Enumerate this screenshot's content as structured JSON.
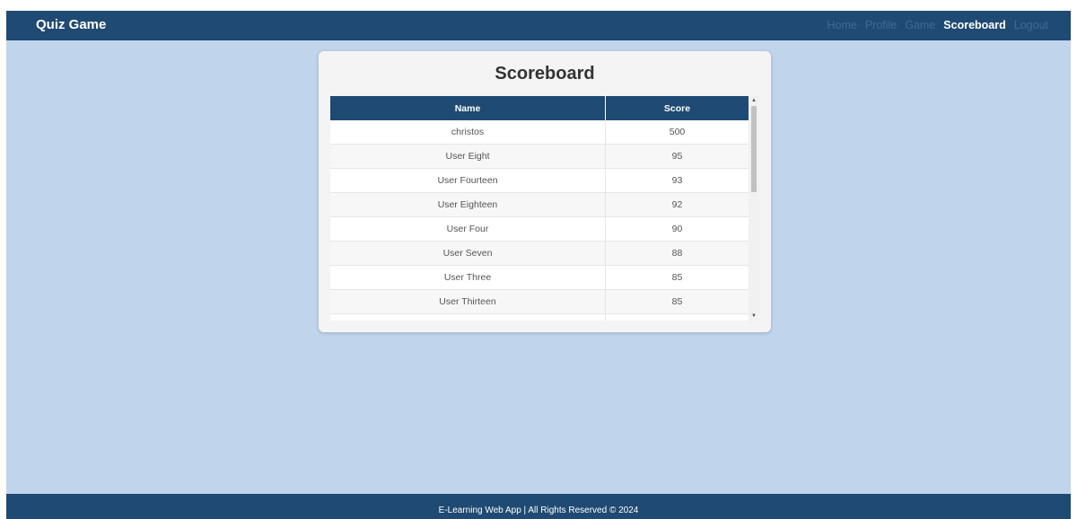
{
  "app": {
    "title": "Quiz Game"
  },
  "nav": {
    "items": [
      {
        "label": "Home",
        "active": false
      },
      {
        "label": "Profile",
        "active": false
      },
      {
        "label": "Game",
        "active": false
      },
      {
        "label": "Scoreboard",
        "active": true
      },
      {
        "label": "Logout",
        "active": false
      }
    ]
  },
  "scoreboard": {
    "title": "Scoreboard",
    "columns": [
      "Name",
      "Score"
    ],
    "rows": [
      {
        "name": "christos",
        "score": "500"
      },
      {
        "name": "User Eight",
        "score": "95"
      },
      {
        "name": "User Fourteen",
        "score": "93"
      },
      {
        "name": "User Eighteen",
        "score": "92"
      },
      {
        "name": "User Four",
        "score": "90"
      },
      {
        "name": "User Seven",
        "score": "88"
      },
      {
        "name": "User Three",
        "score": "85"
      },
      {
        "name": "User Thirteen",
        "score": "85"
      },
      {
        "name": "",
        "score": ""
      }
    ]
  },
  "scrollbar": {
    "up_icon": "▲",
    "down_icon": "▼"
  },
  "footer": {
    "text": "E-Learning Web App | All Rights Reserved © 2024"
  },
  "colors": {
    "navbar": "#1f4a73",
    "background": "#c0d4ec",
    "nav_inactive": "#3e6a96",
    "nav_active": "#ffffff"
  }
}
